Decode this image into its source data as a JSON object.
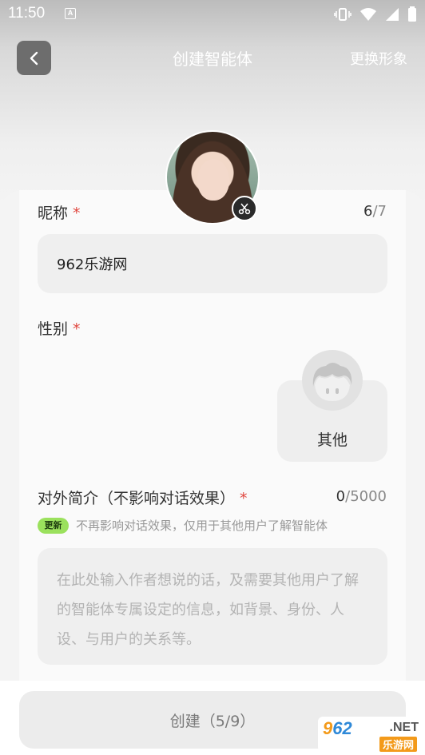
{
  "status_bar": {
    "time": "11:50",
    "notification_letter": "A"
  },
  "header": {
    "title": "创建智能体",
    "change_look": "更换形象"
  },
  "nickname": {
    "label": "昵称",
    "required_mark": "*",
    "count_current": "6",
    "count_max": "/7",
    "value": "962乐游网"
  },
  "gender": {
    "label": "性别",
    "required_mark": "*",
    "option_label": "其他"
  },
  "intro": {
    "label": "对外简介（不影响对话效果）",
    "required_mark": "*",
    "count_current": "0",
    "count_max": "/5000",
    "badge": "更新",
    "hint": "不再影响对话效果，仅用于其他用户了解智能体",
    "placeholder": "在此处输入作者想说的话，及需要其他用户了解的智能体专属设定的信息，如背景、身份、人设、与用户的关系等。"
  },
  "footer": {
    "create_label": "创建（5/9）"
  },
  "watermark": {
    "digits_a": "9",
    "digits_b": "62",
    "suffix": ".NET",
    "cn": "乐游网"
  },
  "colors": {
    "required": "#e0463e",
    "badge_bg": "#9be15d",
    "watermark_orange": "#f39a1a",
    "watermark_blue": "#2f89d8"
  }
}
